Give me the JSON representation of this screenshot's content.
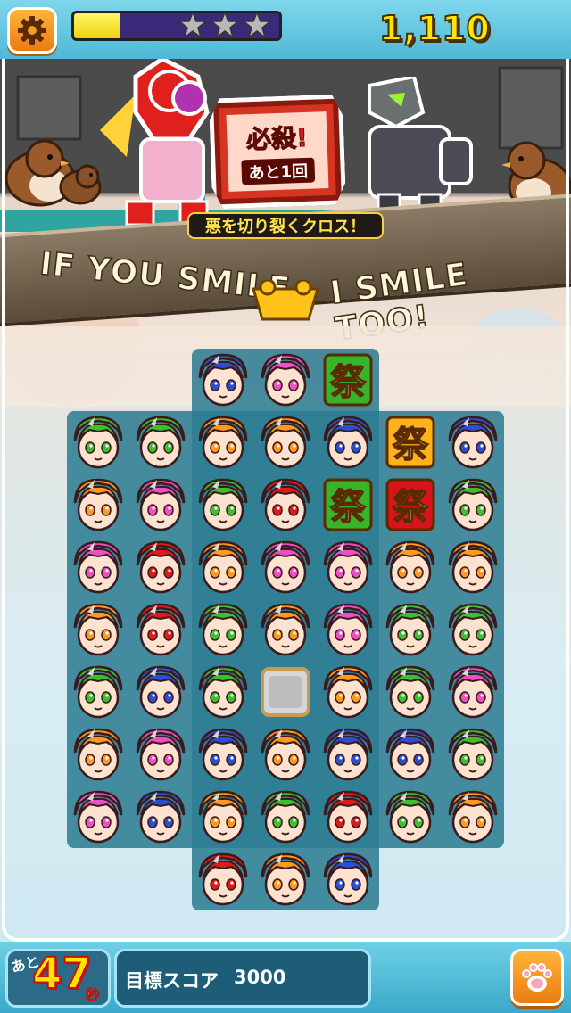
{
  "hud": {
    "settings_icon": "gear-icon",
    "score": "1,110",
    "progress_fraction": 0.22,
    "stars_total": 3,
    "stars_earned": 0
  },
  "stage": {
    "special_title": "必殺!",
    "special_remaining": "あと1回",
    "special_caption": "悪を切り裂くクロス！",
    "slogan_left": "IF YOU SMILE",
    "slogan_right": "I SMILE TOO!"
  },
  "board": {
    "rows": [
      [
        null,
        null,
        "blue",
        "pink",
        "fest-green",
        null,
        null
      ],
      [
        "green",
        "green",
        "orange",
        "orange",
        "blue",
        "fest-orange",
        "blue"
      ],
      [
        "orange",
        "pink",
        "green",
        "red",
        "fest-green",
        "fest-red",
        "green"
      ],
      [
        "pink",
        "red",
        "orange",
        "pink",
        "pink",
        "orange",
        "orange"
      ],
      [
        "orange",
        "red",
        "green",
        "orange",
        "pink",
        "green",
        "green"
      ],
      [
        "green",
        "blue",
        "green",
        "empty",
        "orange",
        "green",
        "pink"
      ],
      [
        "orange",
        "pink",
        "blue",
        "orange",
        "blue",
        "blue",
        "green"
      ],
      [
        "pink",
        "blue",
        "orange",
        "green",
        "red",
        "green",
        "orange"
      ],
      [
        null,
        null,
        "red",
        "orange",
        "blue",
        null,
        null
      ]
    ],
    "tile_colors": {
      "blue": "#2a4fd6",
      "pink": "#ef4fc6",
      "green": "#3cc02e",
      "orange": "#ff9a1f",
      "red": "#e01a1a",
      "fest-green": "#37b52a",
      "fest-orange": "#ffb21a",
      "fest-red": "#d8141a"
    },
    "fest_glyph": "祭"
  },
  "footer": {
    "time_prefix": "あと",
    "time_value": "47",
    "time_unit": "秒",
    "target_label": "目標スコア",
    "target_value": "3000",
    "paw_icon": "paw-icon"
  }
}
